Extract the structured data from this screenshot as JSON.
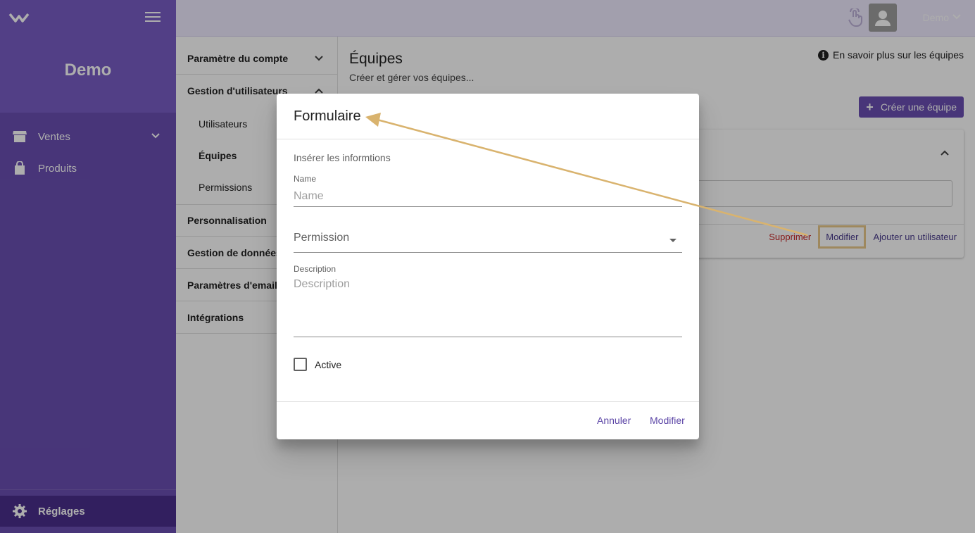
{
  "sidebar": {
    "brand": "Demo",
    "items": [
      {
        "label": "Ventes",
        "icon": "store-icon"
      },
      {
        "label": "Produits",
        "icon": "shopping-bag-icon"
      }
    ],
    "settings_label": "Réglages"
  },
  "topbar": {
    "user_name": "Demo"
  },
  "settings_menu": {
    "items": [
      {
        "label": "Paramètre du compte"
      },
      {
        "label": "Gestion d'utilisateurs"
      },
      {
        "label": "Personnalisation"
      },
      {
        "label": "Gestion de données"
      },
      {
        "label": "Paramètres d'email"
      },
      {
        "label": "Intégrations"
      }
    ],
    "sub_items": [
      {
        "label": "Utilisateurs"
      },
      {
        "label": "Équipes"
      },
      {
        "label": "Permissions"
      }
    ]
  },
  "main": {
    "title": "Équipes",
    "subtitle": "Créer et gérer vos équipes...",
    "learn_more": "En savoir plus sur les équipes",
    "create_button": "Créer une équipe",
    "card_actions": {
      "delete": "Supprimer",
      "edit": "Modifier",
      "add_user": "Ajouter un utilisateur"
    }
  },
  "dialog": {
    "title": "Formulaire",
    "hint": "Insérer les informtions",
    "name_label": "Name",
    "name_placeholder": "Name",
    "permission_placeholder": "Permission",
    "description_label": "Description",
    "description_placeholder": "Description",
    "active_label": "Active",
    "cancel_button": "Annuler",
    "submit_button": "Modifier"
  },
  "colors": {
    "sidebar": "#6a4fb3",
    "accent": "#5b45a6",
    "danger": "#c62828",
    "annotation": "#e9c98b"
  }
}
